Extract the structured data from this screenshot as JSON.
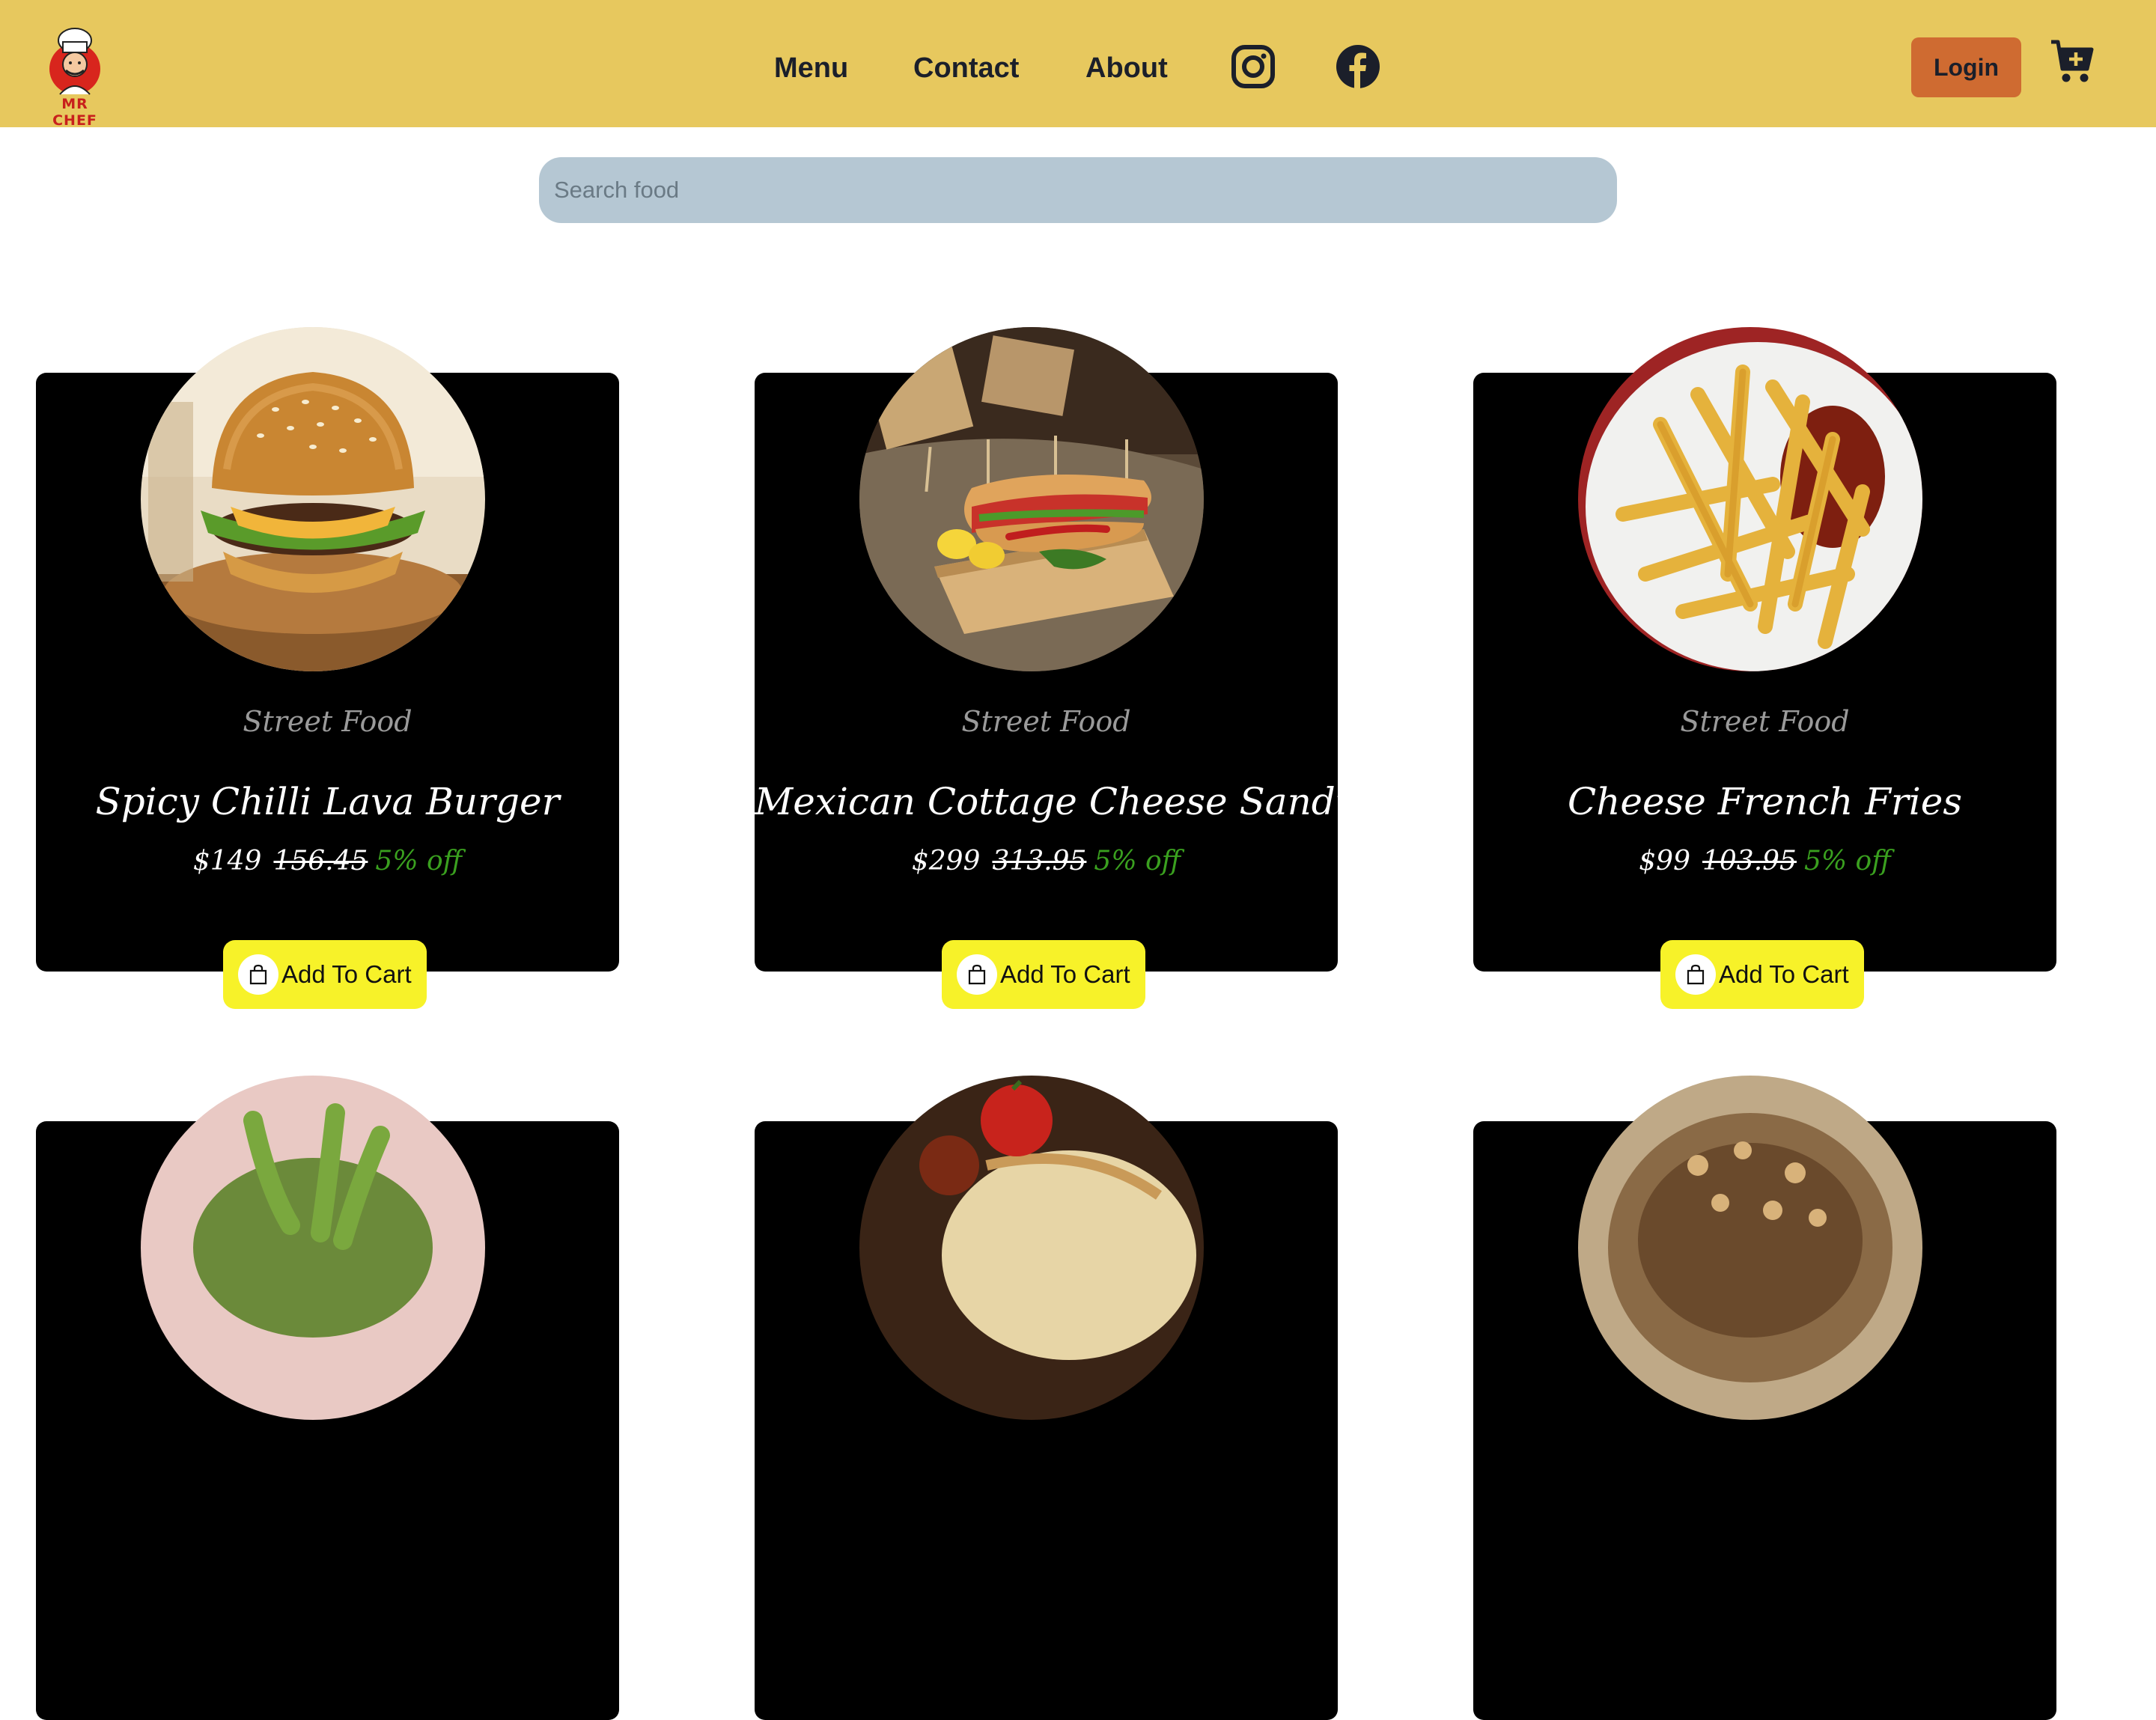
{
  "header": {
    "logo_text": "MR CHEF",
    "nav": [
      {
        "label": "Menu"
      },
      {
        "label": "Contact"
      },
      {
        "label": "About"
      }
    ],
    "social": [
      {
        "icon": "instagram-icon"
      },
      {
        "icon": "facebook-icon"
      }
    ],
    "login_label": "Login",
    "cart_icon": "cart-plus-icon",
    "colors": {
      "background": "#e7c85e",
      "login": "#cf6b31",
      "text": "#1b1f2a"
    }
  },
  "search": {
    "placeholder": "Search food",
    "value": ""
  },
  "products": [
    {
      "category": "Street Food",
      "title": "Spicy Chilli Lava Burger",
      "price": "$149",
      "original_price": "156.45",
      "discount": "5% off",
      "button_label": "Add To Cart",
      "image": "burger"
    },
    {
      "category": "Street Food",
      "title": "Mexican Cottage Cheese Sandwich",
      "price": "$299",
      "original_price": "313.95",
      "discount": "5% off",
      "button_label": "Add To Cart",
      "image": "sandwich"
    },
    {
      "category": "Street Food",
      "title": "Cheese French Fries",
      "price": "$99",
      "original_price": "103.95",
      "discount": "5% off",
      "button_label": "Add To Cart",
      "image": "fries"
    }
  ],
  "theme": {
    "card_bg": "#000000",
    "discount_color": "#3aa01f",
    "button_bg": "#f7f229",
    "search_bg": "#b5c7d3"
  }
}
